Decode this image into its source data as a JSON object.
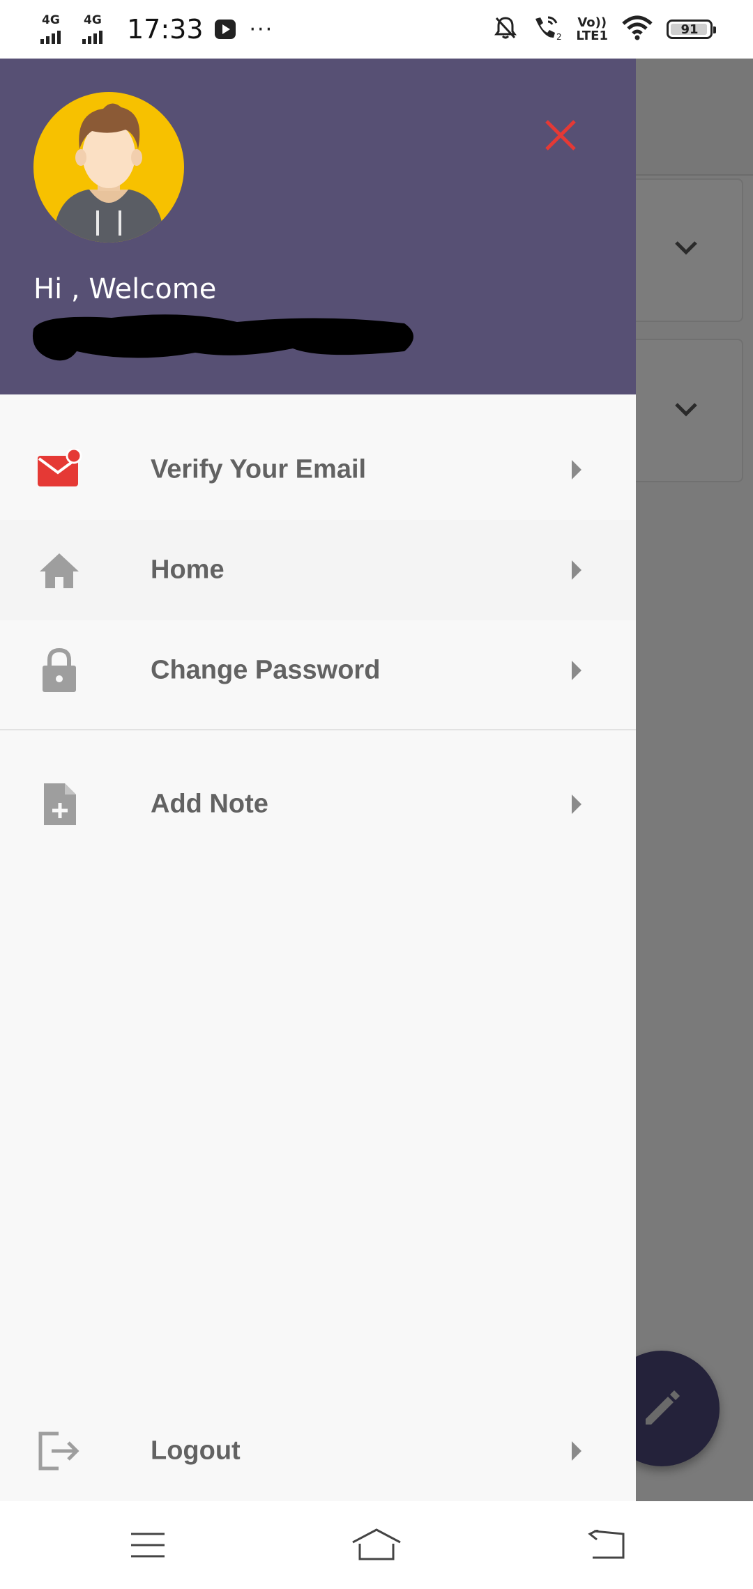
{
  "status_bar": {
    "network_1": "4G",
    "network_2": "4G",
    "time": "17:33",
    "more": "···",
    "volte_top": "Vo))",
    "volte_bottom": "LTE1",
    "battery": "91",
    "icons": [
      "signal-icon",
      "youtube-icon",
      "mute-bell-icon",
      "wifi-call-icon",
      "volte-icon",
      "wifi-icon",
      "battery-icon"
    ]
  },
  "drawer": {
    "header_color": "#575074",
    "greeting": "Hi , Welcome",
    "avatar_icon": "avatar-icon",
    "close_icon": "close-icon",
    "close_color": "#e53935",
    "items": [
      {
        "label": "Verify Your Email",
        "icon": "mail-notification-icon"
      },
      {
        "label": "Home",
        "icon": "home-icon"
      },
      {
        "label": "Change Password",
        "icon": "lock-icon"
      },
      {
        "label": "Add Note",
        "icon": "add-note-icon"
      }
    ],
    "logout": {
      "label": "Logout",
      "icon": "logout-icon"
    }
  },
  "background_app": {
    "more_icon": "more-vert-icon",
    "chevrons": [
      "chevron-down-icon",
      "chevron-down-icon"
    ],
    "fab_icon": "edit-icon"
  },
  "nav_bar": {
    "icons": [
      "menu-icon",
      "home-nav-icon",
      "back-icon"
    ]
  }
}
